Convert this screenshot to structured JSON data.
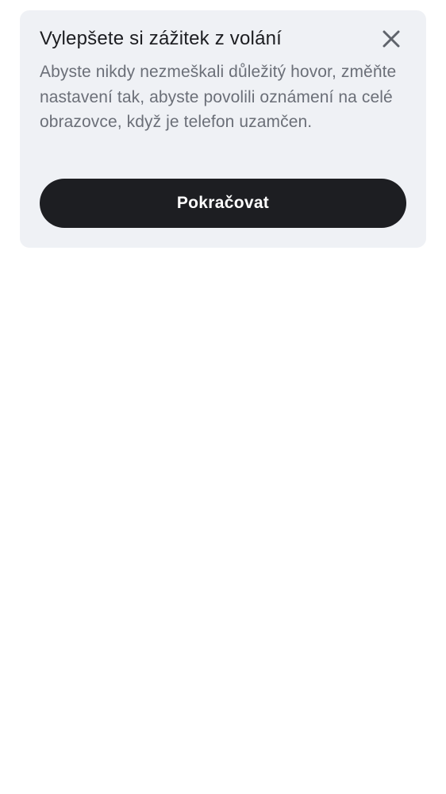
{
  "dialog": {
    "title": "Vylepšete si zážitek z volání",
    "body": "Abyste nikdy nezmeškali důležitý hovor, změňte nastavení tak, abyste povolili oznámení na celé obrazovce, když je telefon uzamčen.",
    "continue_label": "Pokračovat",
    "close_icon": "close-icon"
  },
  "colors": {
    "card_background": "#eff1f5",
    "button_background": "#1d1e22",
    "title_text": "#1c1d21",
    "body_text": "#6b6f78"
  }
}
